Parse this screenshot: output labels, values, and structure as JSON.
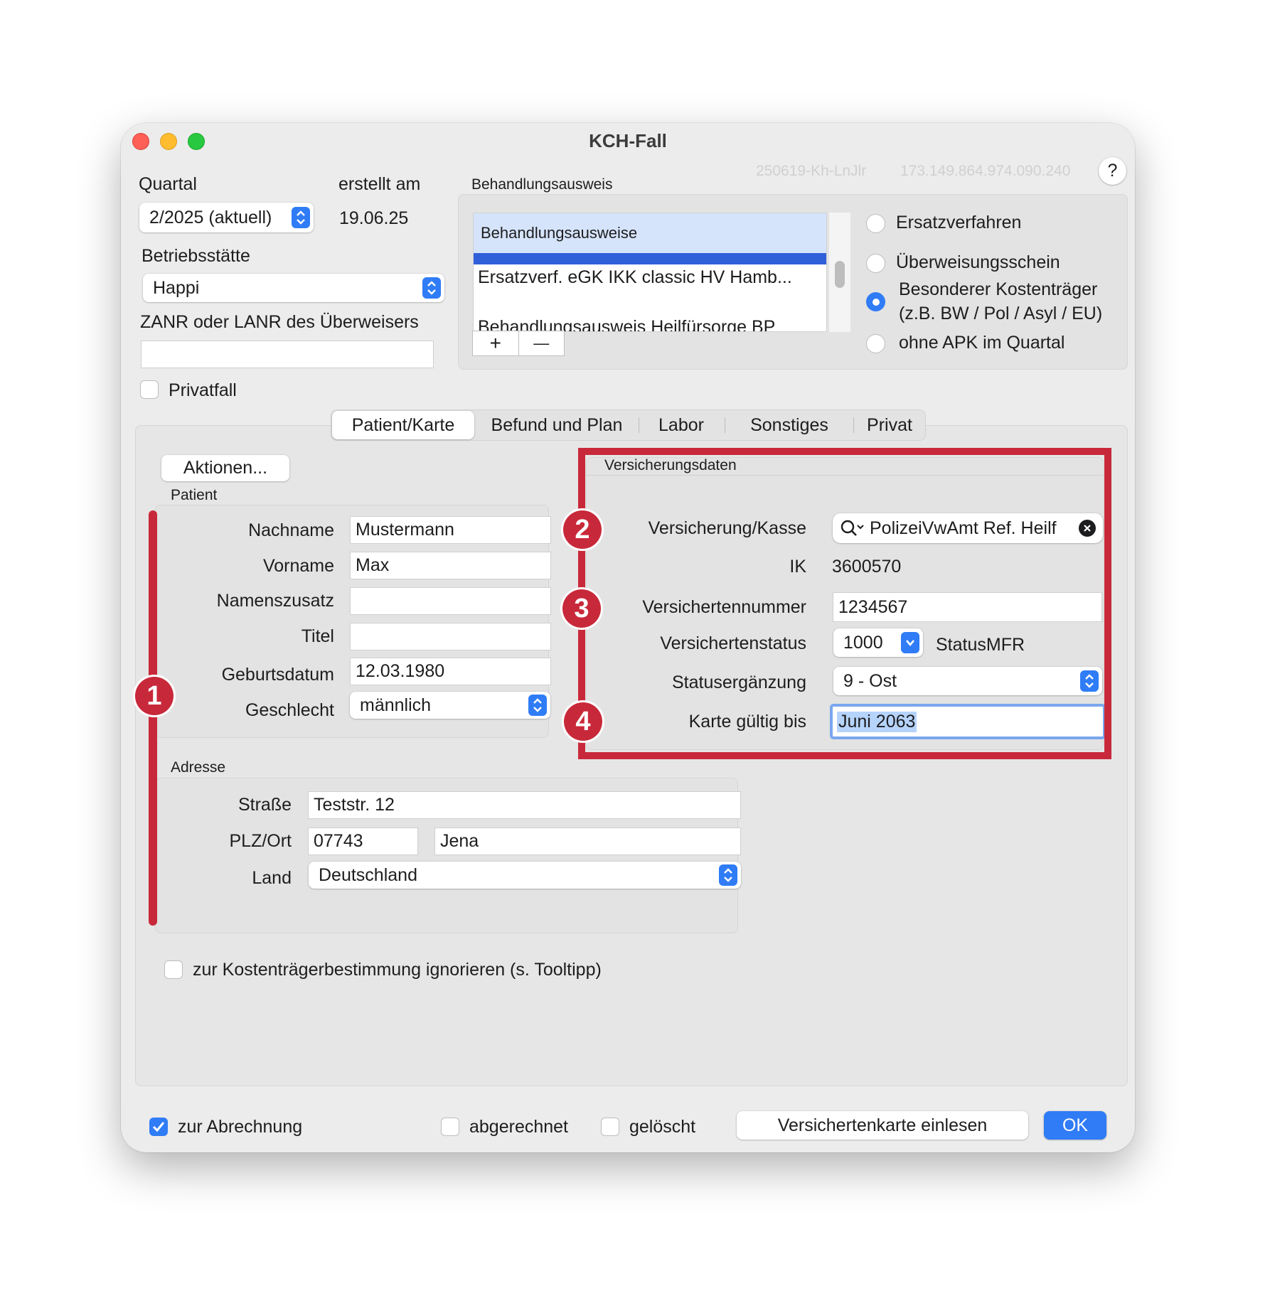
{
  "window": {
    "title": "KCH-Fall"
  },
  "header": {
    "quartal_label": "Quartal",
    "quartal_value": "2/2025 (aktuell)",
    "erstellt_label": "erstellt am",
    "erstellt_value": "19.06.25",
    "id_code": "250619-Kh-LnJlr",
    "ip_code": "173.149.864.974.090.240",
    "help_label": "?",
    "betriebsstaette_label": "Betriebsstätte",
    "betriebsstaette_value": "Happi",
    "zanr_label": "ZANR oder LANR des Überweisers",
    "zanr_value": "",
    "privatfall_label": "Privatfall"
  },
  "behandlungsausweis": {
    "group_label": "Behandlungsausweis",
    "list_header": "Behandlungsausweise",
    "items": [
      "Ersatzverf. eGK IKK classic HV Hamb...",
      "Behandlungsausweis Heilfürsorge BP"
    ],
    "add_label": "+",
    "remove_label": "—",
    "radios": [
      "Ersatzverfahren",
      "Überweisungsschein",
      "Besonderer Kostenträger",
      "(z.B. BW / Pol / Asyl / EU)",
      "ohne APK im Quartal"
    ]
  },
  "tabs": [
    "Patient/Karte",
    "Befund und Plan",
    "Labor",
    "Sonstiges",
    "Privat"
  ],
  "aktionen_label": "Aktionen...",
  "patient": {
    "group_label": "Patient",
    "nachname_label": "Nachname",
    "nachname_value": "Mustermann",
    "vorname_label": "Vorname",
    "vorname_value": "Max",
    "namenszusatz_label": "Namenszusatz",
    "namenszusatz_value": "",
    "titel_label": "Titel",
    "titel_value": "",
    "geburtsdatum_label": "Geburtsdatum",
    "geburtsdatum_value": "12.03.1980",
    "geschlecht_label": "Geschlecht",
    "geschlecht_value": "männlich"
  },
  "adresse": {
    "group_label": "Adresse",
    "strasse_label": "Straße",
    "strasse_value": "Teststr. 12",
    "plzort_label": "PLZ/Ort",
    "plz_value": "07743",
    "ort_value": "Jena",
    "land_label": "Land",
    "land_value": "Deutschland"
  },
  "versicherung": {
    "group_label": "Versicherungsdaten",
    "kasse_label": "Versicherung/Kasse",
    "kasse_value": "PolizeiVwAmt Ref. Heilf",
    "ik_label": "IK",
    "ik_value": "3600570",
    "nummer_label": "Versichertennummer",
    "nummer_value": "1234567",
    "status_label": "Versichertenstatus",
    "status_value": "1000",
    "status_extra": "StatusMFR",
    "ergaenzung_label": "Statusergänzung",
    "ergaenzung_value": "9 - Ost",
    "karte_label": "Karte gültig bis",
    "karte_value": "Juni 2063"
  },
  "markers": [
    "1",
    "2",
    "3",
    "4"
  ],
  "kostentraeger_ignore_label": "zur Kostenträgerbestimmung ignorieren (s. Tooltipp)",
  "footer": {
    "abrechnung_label": "zur Abrechnung",
    "abgerechnet_label": "abgerechnet",
    "geloescht_label": "gelöscht",
    "einlesen_label": "Versichertenkarte einlesen",
    "ok_label": "OK"
  },
  "colors": {
    "accent": "#2f7cf6",
    "marker": "#c8293a",
    "selection": "#b6d4fb",
    "list_header": "#d6e4fb"
  }
}
